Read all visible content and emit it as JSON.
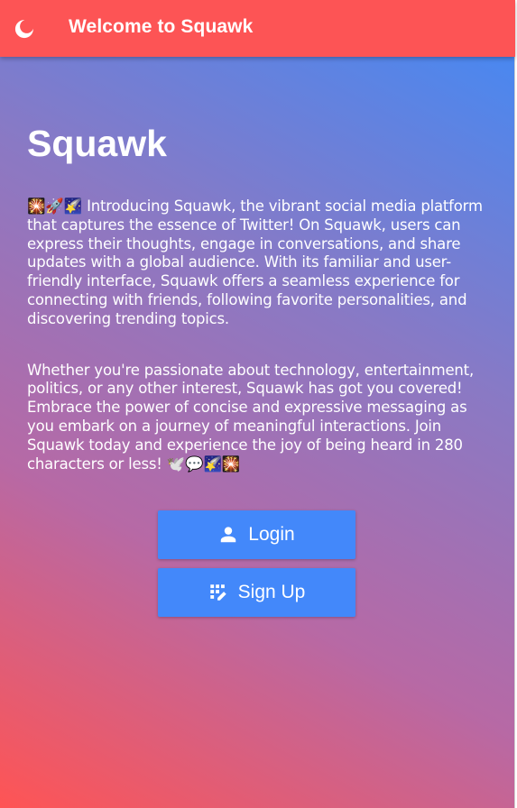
{
  "app_bar": {
    "title": "Welcome to Squawk",
    "theme_icon": "moon-icon",
    "background": "#fd5455"
  },
  "main": {
    "heading": "Squawk",
    "paragraph_1": "🎇🚀🌠 Introducing Squawk, the vibrant social media platform that captures the essence of Twitter! On Squawk, users can express their thoughts, engage in conversations, and share updates with a global audience. With its familiar and user-friendly interface, Squawk offers a seamless experience for connecting with friends, following favorite personalities, and discovering trending topics.",
    "paragraph_2": "Whether you're passionate about technology, entertainment, politics, or any other interest, Squawk has got you covered! Embrace the power of concise and expressive messaging as you embark on a journey of meaningful interactions. Join Squawk today and experience the joy of being heard in 280 characters or less! 🕊️💬🌠🎇"
  },
  "actions": {
    "login_label": "Login",
    "login_icon": "person-icon",
    "signup_label": "Sign Up",
    "signup_icon": "app-registration-icon",
    "button_color": "#4388fa"
  },
  "colors": {
    "gradient_top": "#3f8af7",
    "gradient_bottom": "#ff5454",
    "text": "#ffffff"
  }
}
